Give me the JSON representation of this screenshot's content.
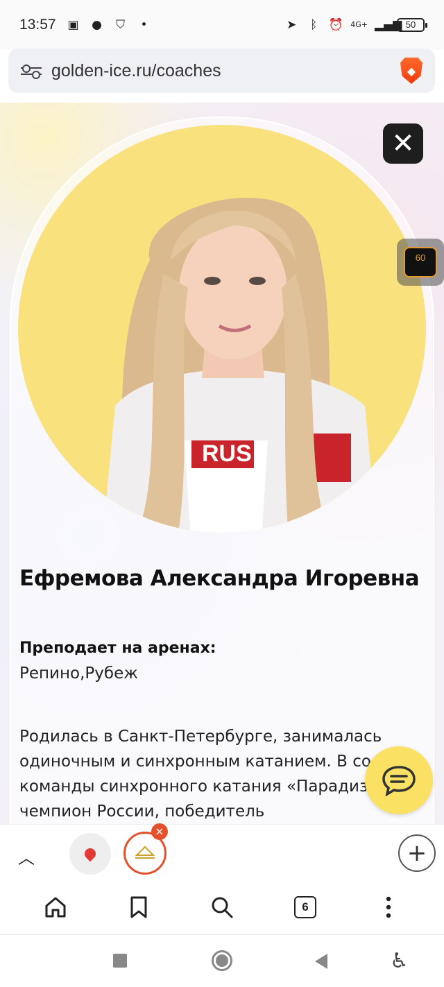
{
  "status_bar": {
    "time": "13:57",
    "network": "4G+",
    "battery": "50"
  },
  "address_bar": {
    "url": "golden-ice.ru/coaches"
  },
  "overlay": {
    "fps": "60"
  },
  "coach": {
    "name": "Ефремова Александра Игоревна",
    "arenas_label": "Преподает на аренах:",
    "arenas_value": "Репино,Рубеж",
    "bio": "Родилась в Санкт-Петербурге, занималась одиночным и синхронным катанием. В составе команды синхронного катания «Парадиз» – чемпион России, победитель"
  },
  "tab_strip": {
    "tab_count": "6"
  },
  "colors": {
    "accent": "#fbe163",
    "avatar_bg": "#f9e27e",
    "tab_ring": "#e5502c"
  }
}
